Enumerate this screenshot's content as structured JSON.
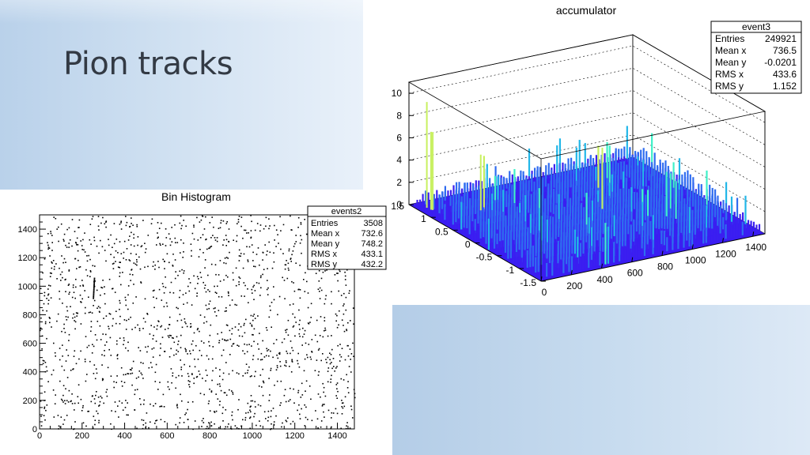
{
  "slide": {
    "title": "Pion tracks"
  },
  "chart_data": [
    {
      "type": "scatter",
      "title": "Bin Histogram",
      "xlim": [
        0,
        1480
      ],
      "ylim": [
        0,
        1500
      ],
      "x_ticks": [
        "0",
        "200",
        "400",
        "600",
        "800",
        "1000",
        "1200",
        "1400"
      ],
      "y_ticks": [
        "0",
        "200",
        "400",
        "600",
        "800",
        "1000",
        "1200",
        "1400"
      ],
      "stats": {
        "name": "events2",
        "rows": [
          {
            "label": "Entries",
            "value": "3508"
          },
          {
            "label": "Mean x",
            "value": "732.6"
          },
          {
            "label": "Mean y",
            "value": "748.2"
          },
          {
            "label": "RMS x",
            "value": "433.1"
          },
          {
            "label": "RMS y",
            "value": "432.2"
          }
        ]
      },
      "points_summary": {
        "entries": 3508,
        "visible_track": {
          "x": [
            250,
            255
          ],
          "y": [
            920,
            1060
          ]
        }
      }
    },
    {
      "type": "lego3d",
      "title": "accumulator",
      "xlim": [
        0,
        1480
      ],
      "ylim": [
        -1.5,
        1.5
      ],
      "zlim": [
        0,
        11
      ],
      "x_ticks": [
        "0",
        "200",
        "400",
        "600",
        "800",
        "1000",
        "1200",
        "1400"
      ],
      "y_ticks": [
        "1.5",
        "1",
        "0.5",
        "0",
        "-0.5",
        "-1",
        "-1.5"
      ],
      "z_ticks": [
        "0",
        "2",
        "4",
        "6",
        "8",
        "10"
      ],
      "stats": {
        "name": "event3",
        "rows": [
          {
            "label": "Entries",
            "value": "249921"
          },
          {
            "label": "Mean x",
            "value": "736.5"
          },
          {
            "label": "Mean y",
            "value": "-0.0201"
          },
          {
            "label": "RMS x",
            "value": "433.6"
          },
          {
            "label": "RMS y",
            "value": "1.152"
          }
        ]
      },
      "peaks": [
        {
          "x": 60,
          "y": 1.3,
          "z": 9.5
        },
        {
          "x": 70,
          "y": 1.2,
          "z": 7.0
        },
        {
          "x": 300,
          "y": 0.9,
          "z": 5.0
        },
        {
          "x": 900,
          "y": 0.2,
          "z": 5.5
        },
        {
          "x": 1150,
          "y": -0.4,
          "z": 4.0
        }
      ],
      "typical_height": [
        0,
        3
      ],
      "colors": [
        "#3b1ff0",
        "#2f6cf0",
        "#22b7e8",
        "#3ff0c8",
        "#c8f060"
      ]
    }
  ]
}
